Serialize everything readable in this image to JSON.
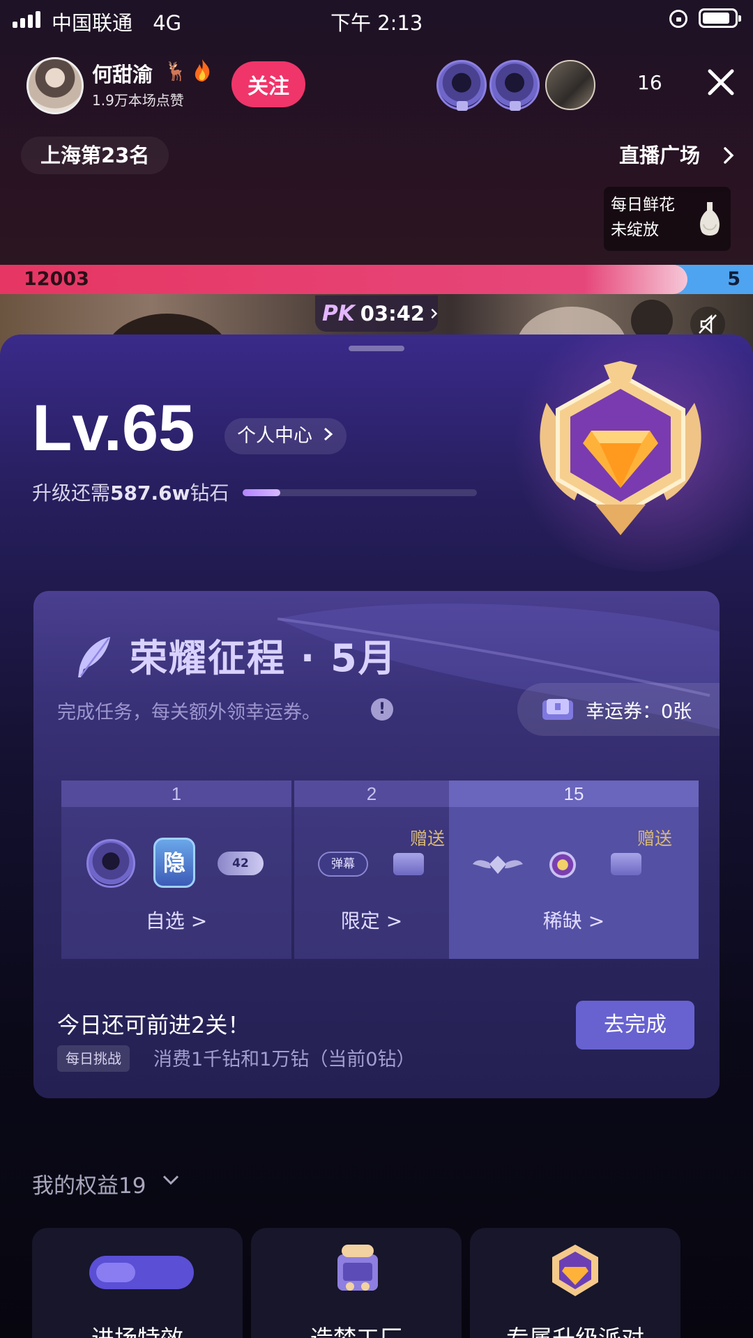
{
  "status_bar": {
    "carrier": "中国联通",
    "network": "4G",
    "time": "下午 2:13"
  },
  "streamer": {
    "name": "何甜渝",
    "likes": "1.9万本场点赞",
    "follow_label": "关注"
  },
  "viewers": {
    "count": "16"
  },
  "city_rank": "上海第23名",
  "plaza_link": "直播广场",
  "flower": {
    "line1": "每日鲜花",
    "line2": "未绽放"
  },
  "pk": {
    "left_score": "12003",
    "right_score": "5",
    "logo": "PK",
    "timer": "03:42",
    "left_share": 0.913,
    "colors": {
      "left": "#e63663",
      "right": "#4ea4f0"
    }
  },
  "level": {
    "title": "Lv.65",
    "center_label": "个人中心",
    "upgrade_prefix": "升级还需",
    "upgrade_amount": "587.6w",
    "upgrade_suffix": "钻石",
    "progress": 0.16
  },
  "journey": {
    "title": "荣耀征程 · 5月",
    "subtitle": "完成任务，每关额外领幸运券。",
    "info_icon": "!",
    "coupon_label": "幸运券：0张",
    "stages": [
      {
        "number": "1",
        "label": "自选"
      },
      {
        "number": "2",
        "label": "限定",
        "tag": "赠送"
      },
      {
        "number": "15",
        "label": "稀缺",
        "tag": "赠送"
      }
    ],
    "reward_texts": {
      "hide": "隐",
      "badge": "42",
      "barrage": "弹幕"
    },
    "today_text": "今日还可前进2关！",
    "daily_tag": "每日挑战",
    "daily_desc": "消费1千钻和1万钻（当前0钻）",
    "complete_button": "去完成"
  },
  "benefits": {
    "title": "我的权益19",
    "items": [
      {
        "label": "进场特效"
      },
      {
        "label": "造梦工厂"
      },
      {
        "label": "专属升级派对"
      }
    ]
  }
}
